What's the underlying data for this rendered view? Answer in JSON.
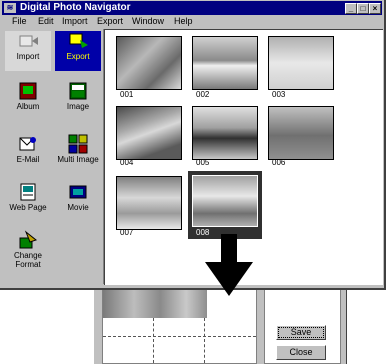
{
  "main_window": {
    "title": "Digital Photo Navigator",
    "min_btn": "_",
    "max_btn": "□",
    "close_btn": "×"
  },
  "menu": [
    "File",
    "Edit",
    "Import",
    "Export",
    "Window",
    "Help"
  ],
  "sidebar": {
    "import": "Import",
    "export": "Export",
    "album": "Album",
    "image": "Image",
    "email": "E-Mail",
    "multi_image": "Multi Image",
    "web_page": "Web Page",
    "movie": "Movie",
    "change_format": "Change Format"
  },
  "thumbnails": [
    {
      "label": "001"
    },
    {
      "label": "002"
    },
    {
      "label": "003"
    },
    {
      "label": "004"
    },
    {
      "label": "005"
    },
    {
      "label": "006"
    },
    {
      "label": "007"
    },
    {
      "label": "008",
      "selected": true
    }
  ],
  "save_window": {
    "save_button": "Save",
    "close_button": "Close"
  },
  "colors": {
    "titlebar": "#000080",
    "selection": "#0000a8",
    "face": "#c0c0c0"
  }
}
